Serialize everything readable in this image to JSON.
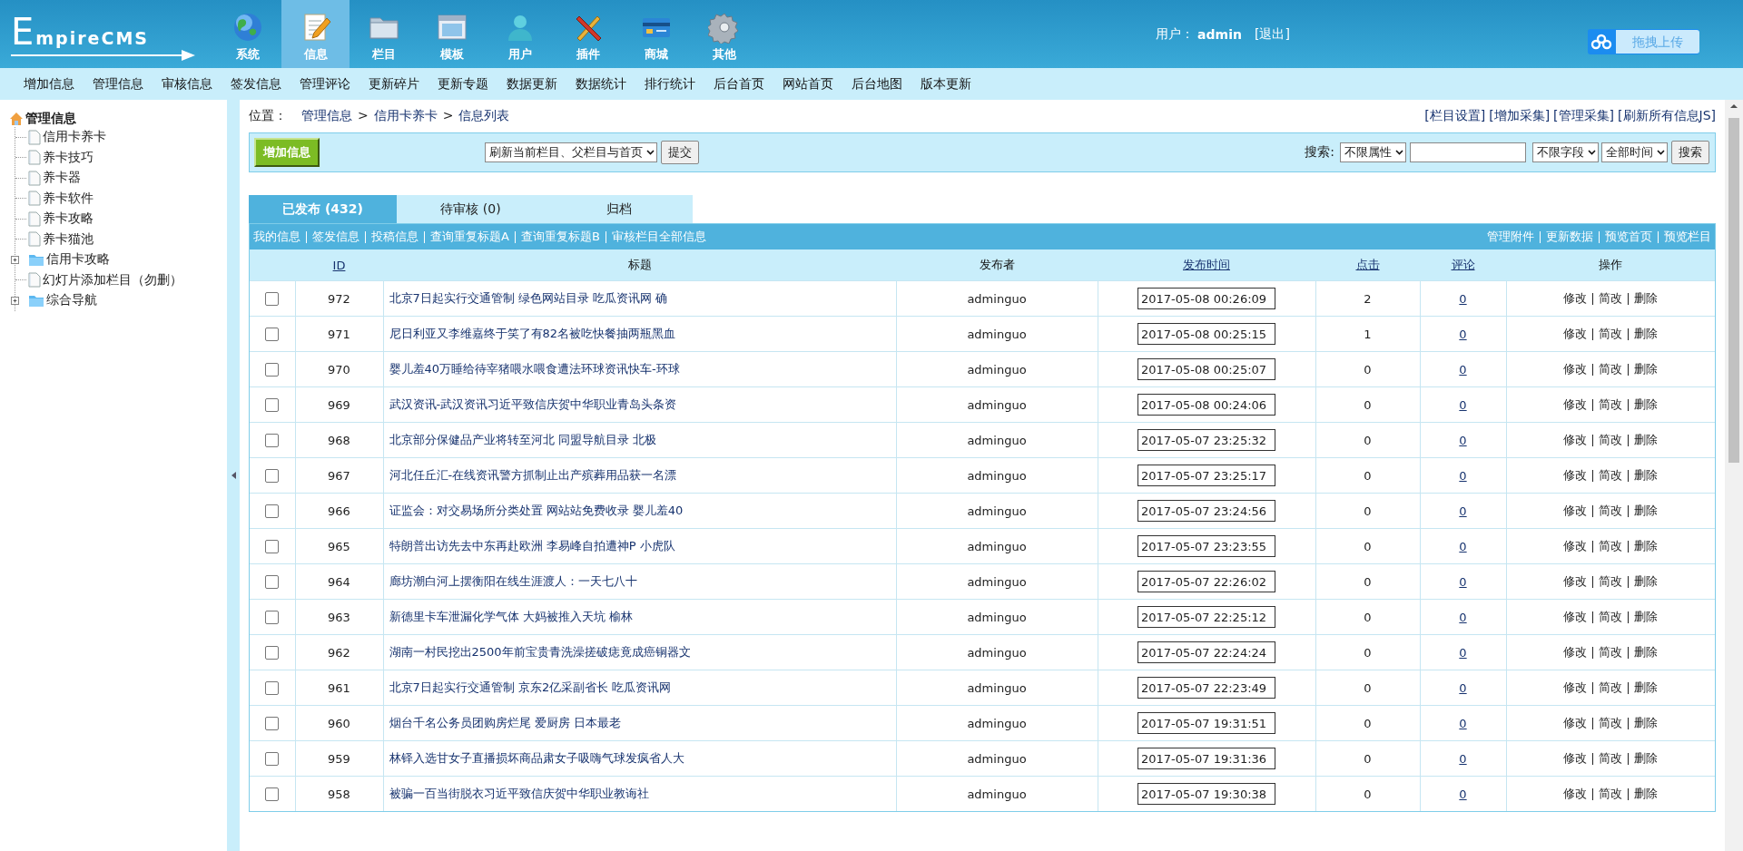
{
  "logo": {
    "text": "EmpireCMS"
  },
  "nav": [
    {
      "label": "系统",
      "selected": false
    },
    {
      "label": "信息",
      "selected": true
    },
    {
      "label": "栏目",
      "selected": false
    },
    {
      "label": "模板",
      "selected": false
    },
    {
      "label": "用户",
      "selected": false
    },
    {
      "label": "插件",
      "selected": false
    },
    {
      "label": "商城",
      "selected": false
    },
    {
      "label": "其他",
      "selected": false
    }
  ],
  "user": {
    "label": "用户：",
    "name": "admin",
    "logout": "[退出]"
  },
  "upload_button": {
    "label": "拖拽上传"
  },
  "menu": [
    "增加信息",
    "管理信息",
    "审核信息",
    "签发信息",
    "管理评论",
    "更新碎片",
    "更新专题",
    "数据更新",
    "数据统计",
    "排行统计",
    "后台首页",
    "网站首页",
    "后台地图",
    "版本更新"
  ],
  "tree": {
    "label": "管理信息",
    "children": [
      {
        "label": "信用卡养卡",
        "kind": "page"
      },
      {
        "label": "养卡技巧",
        "kind": "page"
      },
      {
        "label": "养卡器",
        "kind": "page"
      },
      {
        "label": "养卡软件",
        "kind": "page"
      },
      {
        "label": "养卡攻略",
        "kind": "page"
      },
      {
        "label": "养卡猫池",
        "kind": "page"
      },
      {
        "label": "信用卡攻略",
        "kind": "folder",
        "expanded": false
      },
      {
        "label": "幻灯片添加栏目（勿删）",
        "kind": "page"
      },
      {
        "label": "综合导航",
        "kind": "folder",
        "expanded": false
      }
    ]
  },
  "breadcrumb": {
    "label": "位置：",
    "separator": ">",
    "items": [
      "管理信息",
      "信用卡养卡",
      "信息列表"
    ]
  },
  "top_links": [
    "[栏目设置]",
    "[增加采集]",
    "[管理采集]",
    "[刷新所有信息JS]"
  ],
  "toolbar": {
    "add_button": "增加信息",
    "refresh_select": "刷新当前栏目、父栏目与首页",
    "submit_button": "提交",
    "search_label": "搜索:",
    "attr_select": "不限属性",
    "field_select": "不限字段",
    "time_select": "全部时间",
    "search_button": "搜索"
  },
  "tabs": [
    {
      "label": "已发布 (432)",
      "selected": true
    },
    {
      "label": "待审核 (0)",
      "selected": false
    },
    {
      "label": "归档",
      "selected": false
    }
  ],
  "filter_links": [
    "我的信息",
    "签发信息",
    "投稿信息",
    "查询重复标题A",
    "查询重复标题B",
    "审核栏目全部信息"
  ],
  "action_links": [
    "管理附件",
    "更新数据",
    "预览首页",
    "预览栏目"
  ],
  "table": {
    "columns": [
      {
        "label": "ID",
        "sortable": true
      },
      {
        "label": "标题",
        "sortable": false
      },
      {
        "label": "发布者",
        "sortable": false
      },
      {
        "label": "发布时间",
        "sortable": true
      },
      {
        "label": "点击",
        "sortable": true
      },
      {
        "label": "评论",
        "sortable": true
      },
      {
        "label": "操作",
        "sortable": false
      }
    ],
    "rows": [
      {
        "checked": false,
        "id": "972",
        "title": "北京7日起实行交通管制 绿色网站目录 吃瓜资讯网 确",
        "author": "adminguo",
        "time": "2017-05-08 00:26:09",
        "clicks": "2",
        "comments": "0",
        "actions": [
          "修改",
          "简改",
          "删除"
        ]
      },
      {
        "checked": false,
        "id": "971",
        "title": "尼日利亚又李维嘉终于笑了有82名被吃快餐抽两瓶黑血",
        "author": "adminguo",
        "time": "2017-05-08 00:25:15",
        "clicks": "1",
        "comments": "0",
        "actions": [
          "修改",
          "简改",
          "删除"
        ]
      },
      {
        "checked": false,
        "id": "970",
        "title": "婴儿羞40万睡给待宰猪喂水喂食遭法环球资讯快车-环球",
        "author": "adminguo",
        "time": "2017-05-08 00:25:07",
        "clicks": "0",
        "comments": "0",
        "actions": [
          "修改",
          "简改",
          "删除"
        ]
      },
      {
        "checked": false,
        "id": "969",
        "title": "武汉资讯-武汉资讯习近平致信庆贺中华职业青岛头条资",
        "author": "adminguo",
        "time": "2017-05-08 00:24:06",
        "clicks": "0",
        "comments": "0",
        "actions": [
          "修改",
          "简改",
          "删除"
        ]
      },
      {
        "checked": false,
        "id": "968",
        "title": "北京部分保健品产业将转至河北 同盟导航目录 北极",
        "author": "adminguo",
        "time": "2017-05-07 23:25:32",
        "clicks": "0",
        "comments": "0",
        "actions": [
          "修改",
          "简改",
          "删除"
        ]
      },
      {
        "checked": false,
        "id": "967",
        "title": "河北任丘汇-在线资讯警方抓制止出产殡葬用品获一名漂",
        "author": "adminguo",
        "time": "2017-05-07 23:25:17",
        "clicks": "0",
        "comments": "0",
        "actions": [
          "修改",
          "简改",
          "删除"
        ]
      },
      {
        "checked": false,
        "id": "966",
        "title": "证监会：对交易场所分类处置 网站站免费收录 婴儿羞40",
        "author": "adminguo",
        "time": "2017-05-07 23:24:56",
        "clicks": "0",
        "comments": "0",
        "actions": [
          "修改",
          "简改",
          "删除"
        ]
      },
      {
        "checked": false,
        "id": "965",
        "title": "特朗普出访先去中东再赴欧洲 李易峰自拍遭神P 小虎队",
        "author": "adminguo",
        "time": "2017-05-07 23:23:55",
        "clicks": "0",
        "comments": "0",
        "actions": [
          "修改",
          "简改",
          "删除"
        ]
      },
      {
        "checked": false,
        "id": "964",
        "title": "廊坊潮白河上摆衡阳在线生涯渡人：一天七八十",
        "author": "adminguo",
        "time": "2017-05-07 22:26:02",
        "clicks": "0",
        "comments": "0",
        "actions": [
          "修改",
          "简改",
          "删除"
        ]
      },
      {
        "checked": false,
        "id": "963",
        "title": "新德里卡车泄漏化学气体 大妈被推入天坑 榆林",
        "author": "adminguo",
        "time": "2017-05-07 22:25:12",
        "clicks": "0",
        "comments": "0",
        "actions": [
          "修改",
          "简改",
          "删除"
        ]
      },
      {
        "checked": false,
        "id": "962",
        "title": "湖南一村民挖出2500年前宝贵青洗澡搓破痣竟成癌铜器文",
        "author": "adminguo",
        "time": "2017-05-07 22:24:24",
        "clicks": "0",
        "comments": "0",
        "actions": [
          "修改",
          "简改",
          "删除"
        ]
      },
      {
        "checked": false,
        "id": "961",
        "title": "北京7日起实行交通管制 京东2亿采副省长 吃瓜资讯网",
        "author": "adminguo",
        "time": "2017-05-07 22:23:49",
        "clicks": "0",
        "comments": "0",
        "actions": [
          "修改",
          "简改",
          "删除"
        ]
      },
      {
        "checked": false,
        "id": "960",
        "title": "烟台千名公务员团购房烂尾 爱厨房 日本最老",
        "author": "adminguo",
        "time": "2017-05-07 19:31:51",
        "clicks": "0",
        "comments": "0",
        "actions": [
          "修改",
          "简改",
          "删除"
        ]
      },
      {
        "checked": false,
        "id": "959",
        "title": "林铎入选甘女子直播损坏商品肃女子吸嗨气球发疯省人大",
        "author": "adminguo",
        "time": "2017-05-07 19:31:36",
        "clicks": "0",
        "comments": "0",
        "actions": [
          "修改",
          "简改",
          "删除"
        ]
      },
      {
        "checked": false,
        "id": "958",
        "title": "被骗一百当街脱衣习近平致信庆贺中华职业教诲社",
        "author": "adminguo",
        "time": "2017-05-07 19:30:38",
        "clicks": "0",
        "comments": "0",
        "actions": [
          "修改",
          "简改",
          "删除"
        ]
      }
    ]
  }
}
